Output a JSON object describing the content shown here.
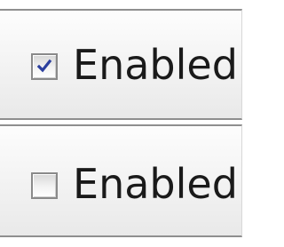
{
  "options": [
    {
      "label": "Enabled",
      "checked": true,
      "check_icon": "checkmark-icon"
    },
    {
      "label": "Enabled",
      "checked": false
    }
  ],
  "colors": {
    "check_mark": "#2b3f9e",
    "box_border": "#8a8a8a",
    "row_border": "#8f8f8f",
    "text": "#1a1a1a"
  }
}
